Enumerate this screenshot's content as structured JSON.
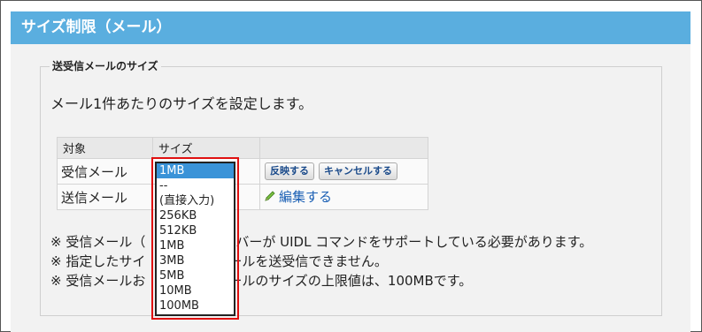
{
  "header": {
    "title": "サイズ制限（メール）"
  },
  "section": {
    "legend": "送受信メールのサイズ",
    "description": "メール1件あたりのサイズを設定します。"
  },
  "table": {
    "headers": [
      "対象",
      "サイズ",
      ""
    ],
    "rows": [
      {
        "label": "受信メール"
      },
      {
        "label": "送信メール"
      }
    ]
  },
  "buttons": {
    "apply": "反映する",
    "cancel": "キャンセルする",
    "edit": "編集する"
  },
  "dropdown": {
    "selected": "1MB",
    "options": [
      "1MB",
      "--",
      "(直接入力)",
      "256KB",
      "512KB",
      "1MB",
      "3MB",
      "5MB",
      "10MB",
      "100MB"
    ]
  },
  "notes": [
    "※ 受信メール（",
    "※ 指定したサイ",
    "※ 受信メールお"
  ],
  "notes_right": [
    "バーが UIDL コマンドをサポートしている必要があります。",
    "ールを送受信できません。",
    "ールのサイズの上限値は、100MBです。"
  ],
  "colors": {
    "header_bg": "#5aaedf",
    "highlight_border": "#e01010",
    "selected_bg": "#3a93d8"
  }
}
